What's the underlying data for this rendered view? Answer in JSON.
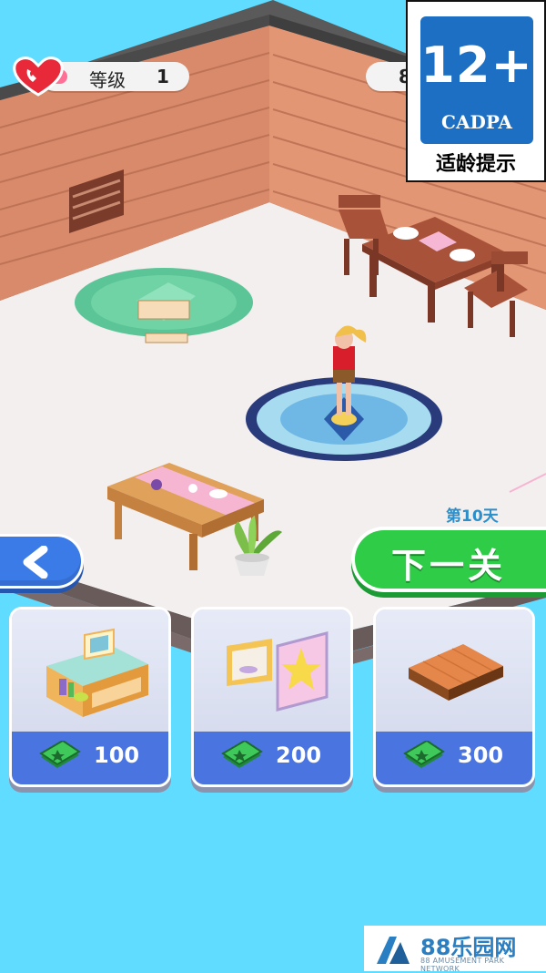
{
  "hud": {
    "level_label": "等级",
    "level_value": "1",
    "coins_value": "8"
  },
  "age_rating": {
    "number": "12+",
    "org": "CADPA",
    "tip": "适龄提示"
  },
  "day_label": "第10天",
  "next_button_label": "下一关",
  "shop": {
    "items": [
      {
        "icon": "shelf-icon",
        "price": "100"
      },
      {
        "icon": "pictures-icon",
        "price": "200"
      },
      {
        "icon": "floor-tile-icon",
        "price": "300"
      }
    ]
  },
  "watermark": {
    "title": "88乐园网",
    "subtitle": "88 AMUSEMENT PARK NETWORK"
  },
  "colors": {
    "background": "#5fdcff",
    "next_button": "#2ecc47",
    "back_button": "#3b7be8",
    "card_price_bar": "#4a74e0",
    "age_badge": "#1d6fc3"
  }
}
